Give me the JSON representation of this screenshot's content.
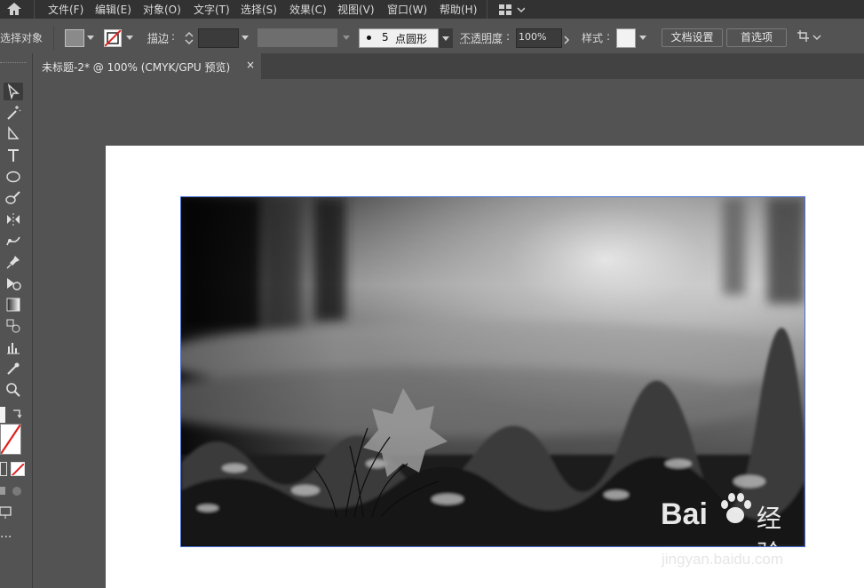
{
  "menubar": {
    "items": [
      "文件(F)",
      "编辑(E)",
      "对象(O)",
      "文字(T)",
      "选择(S)",
      "效果(C)",
      "视图(V)",
      "窗口(W)",
      "帮助(H)"
    ]
  },
  "control_bar": {
    "selection_label": "选择对象",
    "stroke_label": "描边",
    "brush_size": "5",
    "brush_shape": "点圆形",
    "opacity_label": "不透明度",
    "opacity_value": "100%",
    "style_label": "样式",
    "doc_setup_button": "文档设置",
    "preferences_button": "首选项"
  },
  "tabs": [
    {
      "label": "未标题-2* @ 100% (CMYK/GPU 预览)",
      "close": "×"
    }
  ],
  "canvas": {
    "image_description_colors": {
      "artboard": "#ffffff",
      "pasteboard": "#535353",
      "selection": "#4a6fd6"
    },
    "watermark": {
      "brand": "Bai",
      "brand_suffix": "经验",
      "url": "jingyan.baidu.com"
    }
  },
  "colors": {
    "menubar": "#323232",
    "panel": "#535353",
    "tabbar": "#424242"
  }
}
